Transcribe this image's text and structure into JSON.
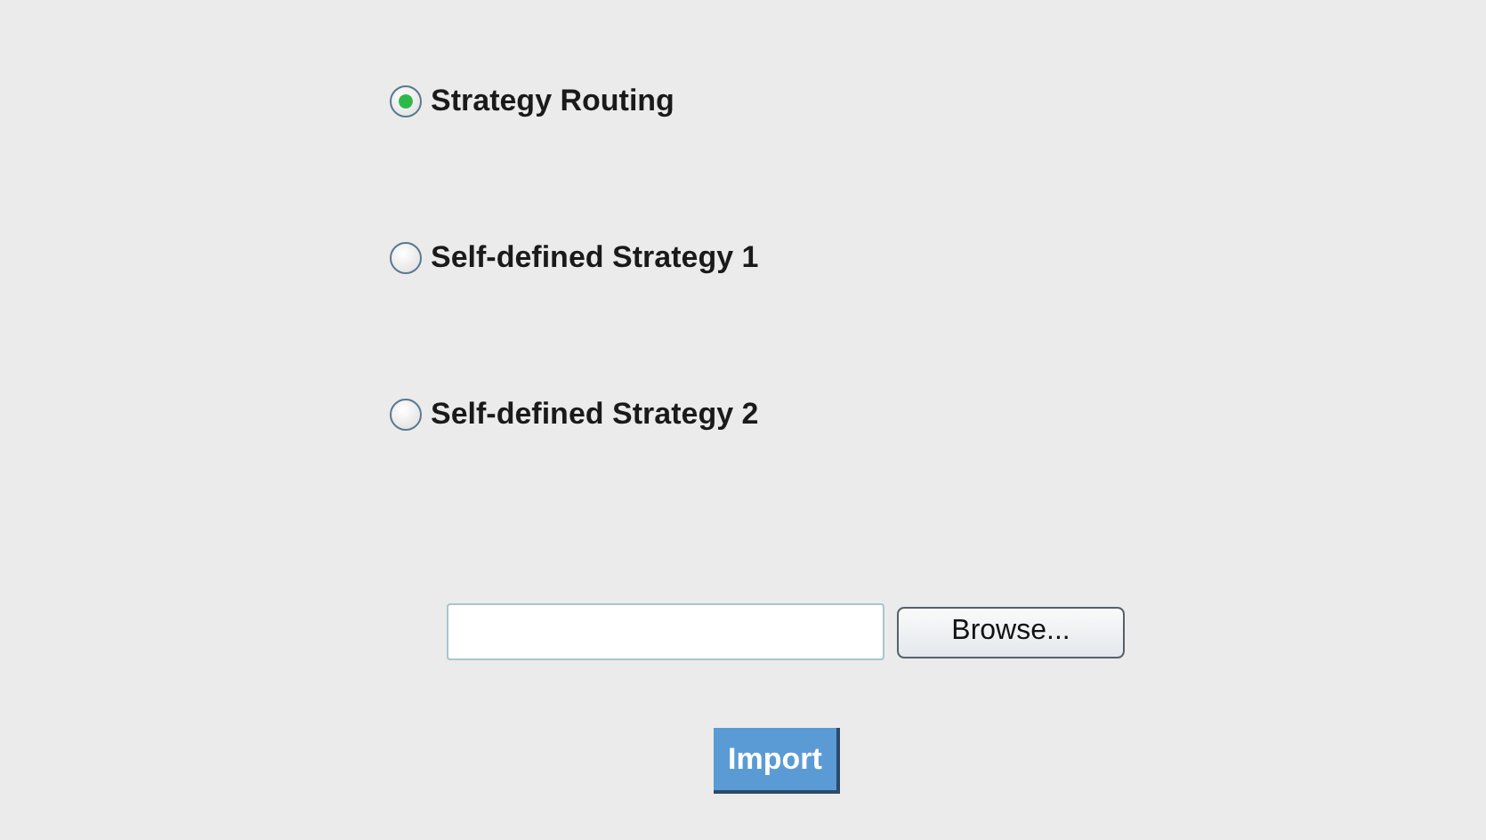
{
  "strategies": [
    {
      "label": "Strategy Routing",
      "selected": true
    },
    {
      "label": "Self-defined Strategy 1",
      "selected": false
    },
    {
      "label": "Self-defined Strategy 2",
      "selected": false
    }
  ],
  "file_upload": {
    "browse_button": "Browse..."
  },
  "import_button": "Import"
}
